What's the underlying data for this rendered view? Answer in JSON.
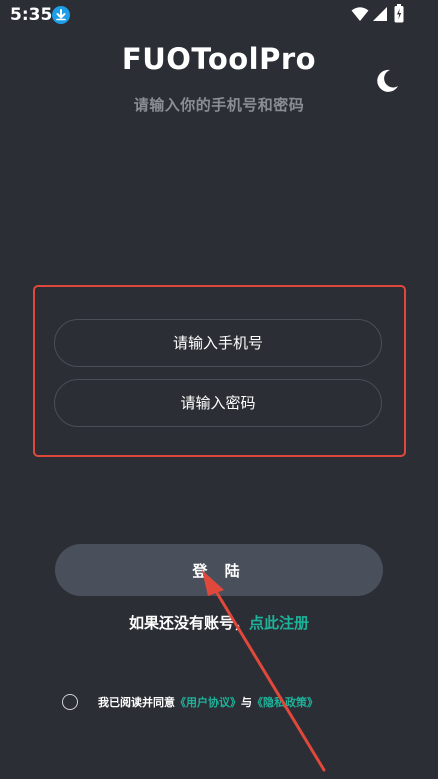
{
  "status_bar": {
    "time": "5:35"
  },
  "header": {
    "title": "FUOToolPro",
    "subtitle": "请输入你的手机号和密码"
  },
  "form": {
    "phone_placeholder": "请输入手机号",
    "password_placeholder": "请输入密码"
  },
  "login": {
    "button_label": "登 陆"
  },
  "register": {
    "prompt": "如果还没有账号，",
    "link": "点此注册"
  },
  "agreement": {
    "text": "我已阅读并同意",
    "user_agreement": "《用户协议》",
    "conjunction": "与",
    "privacy_policy": "《隐私政策》",
    "checked": false
  },
  "colors": {
    "background": "#2b2e35",
    "accent": "#1fb29a",
    "highlight_border": "#e0483b",
    "button": "#4a505b"
  },
  "icons": [
    "download-icon",
    "wifi-icon",
    "signal-icon",
    "battery-icon",
    "moon-icon"
  ]
}
